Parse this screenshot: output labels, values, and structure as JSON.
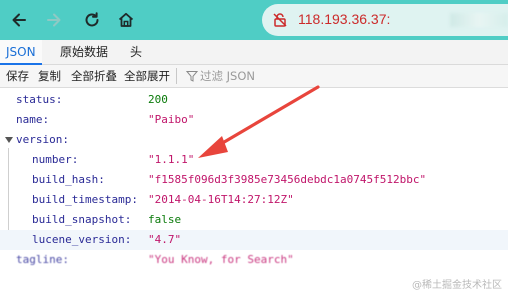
{
  "browser": {
    "address": "118.193.36.37:",
    "icons": {
      "back": "arrow-left-icon",
      "forward": "arrow-right-icon",
      "reload": "reload-icon",
      "home": "home-icon",
      "security": "not-secure-icon"
    }
  },
  "viewer": {
    "tabs": [
      {
        "label": "JSON",
        "active": true
      },
      {
        "label": "原始数据"
      },
      {
        "label": "头"
      }
    ],
    "toolbar": {
      "save": "保存",
      "copy": "复制",
      "collapse_all": "全部折叠",
      "expand_all": "全部展开",
      "filter_placeholder": "过滤 JSON",
      "filter_icon": "filter-icon"
    }
  },
  "json_rows": [
    {
      "key": "status:",
      "value": "200",
      "type": "number"
    },
    {
      "key": "name:",
      "value": "\"Paibo\"",
      "type": "string"
    },
    {
      "key": "version:",
      "value": "",
      "type": "object"
    },
    {
      "key": "number:",
      "value": "\"1.1.1\"",
      "type": "string"
    },
    {
      "key": "build_hash:",
      "value": "\"f1585f096d3f3985e73456debdc1a0745f512bbc\"",
      "type": "string"
    },
    {
      "key": "build_timestamp:",
      "value": "\"2014-04-16T14:27:12Z\"",
      "type": "string"
    },
    {
      "key": "build_snapshot:",
      "value": "false",
      "type": "boolean"
    },
    {
      "key": "lucene_version:",
      "value": "\"4.7\"",
      "type": "string"
    },
    {
      "key": "tagline:",
      "value": "\"You Know, for Search\"",
      "type": "string"
    }
  ],
  "annotation": {
    "color": "#e8453c"
  },
  "watermark": "@稀土掘金技术社区",
  "colors": {
    "navbar": "#4fcdc5",
    "key": "#2a2a96",
    "string": "#c0156a",
    "number": "#0a7a0a"
  }
}
